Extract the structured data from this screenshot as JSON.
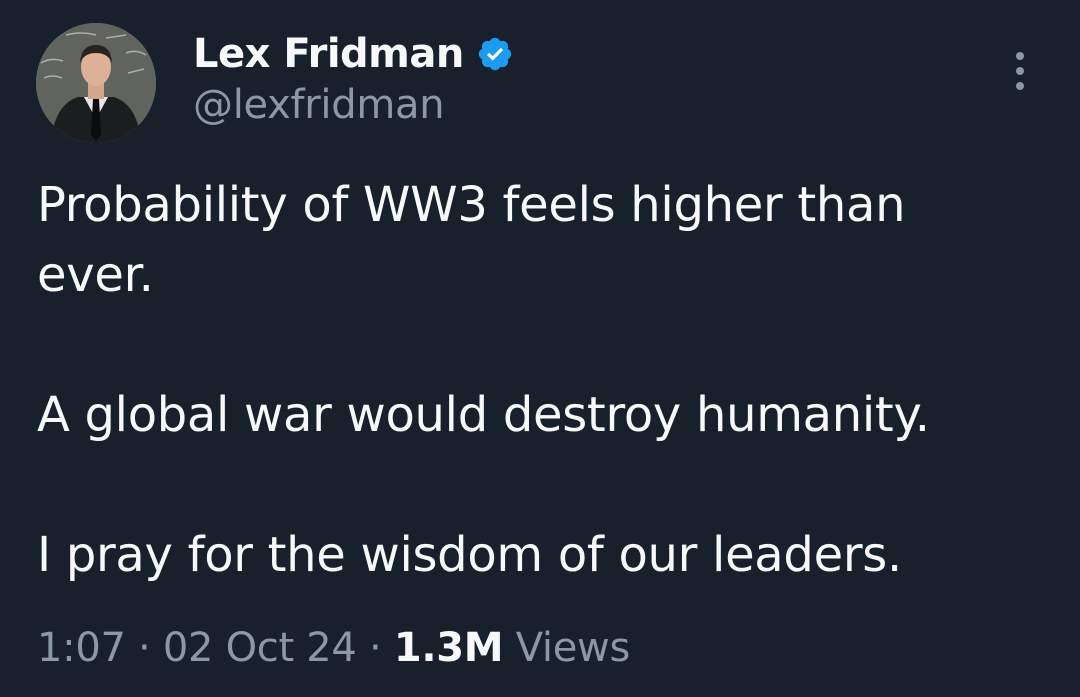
{
  "author": {
    "display_name": "Lex Fridman",
    "handle": "@lexfridman",
    "verified": true,
    "verified_color": "#1d9bf0"
  },
  "post": {
    "lines": [
      "Probability of WW3 feels higher than",
      "ever.",
      "A global war would destroy humanity.",
      "I pray for the wisdom of our leaders."
    ]
  },
  "meta": {
    "time": "1:07",
    "separator": "·",
    "date": "02 Oct 24",
    "views_count": "1.3M",
    "views_label": "Views"
  },
  "icons": {
    "more": "more-vertical-icon",
    "verified": "verified-badge-icon"
  },
  "colors": {
    "background": "#17202b",
    "primary_text": "#f7f9f9",
    "secondary_text": "#8b98a5"
  }
}
